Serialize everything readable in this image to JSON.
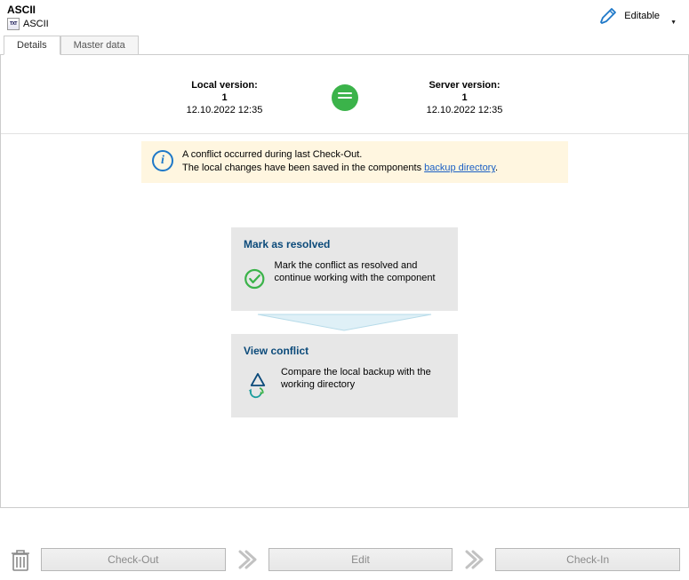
{
  "header": {
    "title": "ASCII",
    "subtitle": "ASCII",
    "editable_label": "Editable"
  },
  "tabs": {
    "details": "Details",
    "master_data": "Master data"
  },
  "versions": {
    "local_label": "Local version:",
    "local_num": "1",
    "local_date": "12.10.2022 12:35",
    "server_label": "Server version:",
    "server_num": "1",
    "server_date": "12.10.2022 12:35"
  },
  "notice": {
    "line1": "A conflict occurred during last Check-Out.",
    "line2_prefix": "The local changes have been saved in the components ",
    "line2_link": "backup directory",
    "line2_suffix": "."
  },
  "cards": {
    "resolve_title": "Mark as resolved",
    "resolve_text": "Mark the conflict as resolved and continue working with the component",
    "view_title": "View conflict",
    "view_text": "Compare the local backup with the working directory"
  },
  "footer": {
    "check_out": "Check-Out",
    "edit": "Edit",
    "check_in": "Check-In"
  }
}
